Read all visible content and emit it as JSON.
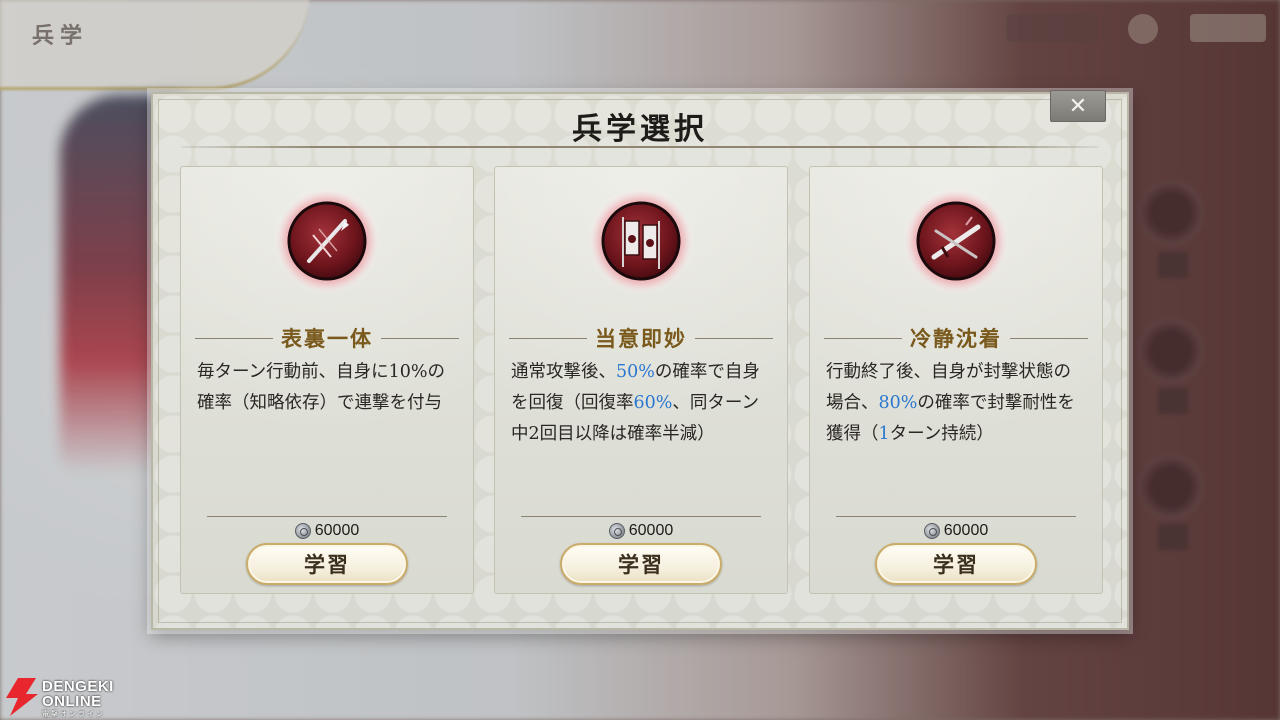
{
  "background": {
    "corner_title": "兵学"
  },
  "dialog": {
    "title": "兵学選択",
    "close_label": "✕"
  },
  "cards": [
    {
      "name": "表裏一体",
      "icon": "spear-slash-icon",
      "description_parts": [
        {
          "text": "毎ターン行動前、自身に10%の確率（知略依存）で連撃を付与",
          "highlight": false
        }
      ],
      "cost": "60000",
      "button_label": "学習"
    },
    {
      "name": "当意即妙",
      "icon": "war-banners-icon",
      "description_parts": [
        {
          "text": "通常攻撃後、",
          "highlight": false
        },
        {
          "text": "50%",
          "highlight": true
        },
        {
          "text": "の確率で自身を回復（回復率",
          "highlight": false
        },
        {
          "text": "60%",
          "highlight": true
        },
        {
          "text": "、同ターン中2回目以降は確率半減）",
          "highlight": false
        }
      ],
      "cost": "60000",
      "button_label": "学習"
    },
    {
      "name": "冷静沈着",
      "icon": "crossed-swords-icon",
      "description_parts": [
        {
          "text": "行動終了後、自身が封撃状態の場合、",
          "highlight": false
        },
        {
          "text": "80%",
          "highlight": true
        },
        {
          "text": "の確率で封撃耐性を獲得（",
          "highlight": false
        },
        {
          "text": "1",
          "highlight": true
        },
        {
          "text": "ターン持続）",
          "highlight": false
        }
      ],
      "cost": "60000",
      "button_label": "学習"
    }
  ],
  "colors": {
    "highlight": "#2a78d0",
    "skill_name": "#7a5a1c",
    "icon_red": "#8e1f25"
  },
  "watermark": {
    "line1": "DENGEKI",
    "line2": "ONLINE",
    "line3": "電撃オンライン"
  }
}
